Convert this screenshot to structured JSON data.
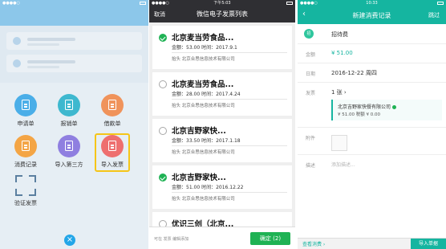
{
  "panel1": {
    "menu": [
      {
        "label": "申请单",
        "color": "#4aaee8",
        "icon": "document-icon"
      },
      {
        "label": "报销单",
        "color": "#3eb8cf",
        "icon": "receipt-icon"
      },
      {
        "label": "借款单",
        "color": "#f0935b",
        "icon": "loan-icon"
      },
      {
        "label": "消费记录",
        "color": "#f4a545",
        "icon": "record-icon"
      },
      {
        "label": "导入第三方",
        "color": "#8f7fe0",
        "icon": "import-icon"
      },
      {
        "label": "导入发票",
        "color": "#ee6f6f",
        "icon": "invoice-icon"
      },
      {
        "label": "验证发票",
        "color": "",
        "icon": "scan-icon"
      }
    ],
    "close_symbol": "×"
  },
  "panel2": {
    "status_time": "下午5:03",
    "back_label": "取消",
    "title": "微信电子发票列表",
    "invoices": [
      {
        "name": "北京麦当劳食品...",
        "amount": "金额：53.00 时间：2017.9.1",
        "buyer": "抬头 北京合思信息技术有限公司",
        "checked": true
      },
      {
        "name": "北京麦当劳食品...",
        "amount": "金额：28.00 时间：2017.4.24",
        "buyer": "抬头 北京合思信息技术有限公司",
        "checked": false
      },
      {
        "name": "北京吉野家快...",
        "amount": "金额：33.50 时间：2017.1.18",
        "buyer": "抬头 北京合思信息技术有限公司",
        "checked": false
      },
      {
        "name": "北京吉野家快...",
        "amount": "金额：51.00 时间：2016.12.22",
        "buyer": "抬头 北京合思信息技术有限公司",
        "checked": true
      },
      {
        "name": "优识三创（北京...",
        "amount": "",
        "buyer": "",
        "checked": false
      }
    ],
    "footer_hint": "可在 发票 编辑添加",
    "confirm_label": "确定 (2)"
  },
  "panel3": {
    "status_time": "10:33",
    "title": "新建消费记录",
    "skip_label": "跳过",
    "back_icon": "‹",
    "category": {
      "icon_text": "招",
      "value": "招待费"
    },
    "amount": {
      "label": "金额",
      "value": "¥ 51.00"
    },
    "date": {
      "label": "日期",
      "value": "2016-12-22 周四"
    },
    "invoice": {
      "label": "发票",
      "count": "1  张  ›"
    },
    "invoice_card": {
      "title": "北京吉野家快餐有限公司",
      "values": "¥ 51.00   税额 ¥ 0.00"
    },
    "attachment": {
      "label": "附件"
    },
    "description": {
      "label": "描述",
      "placeholder": "添加描述..."
    },
    "footer_left": "查看消费 ›",
    "footer_right": "导入单据"
  }
}
